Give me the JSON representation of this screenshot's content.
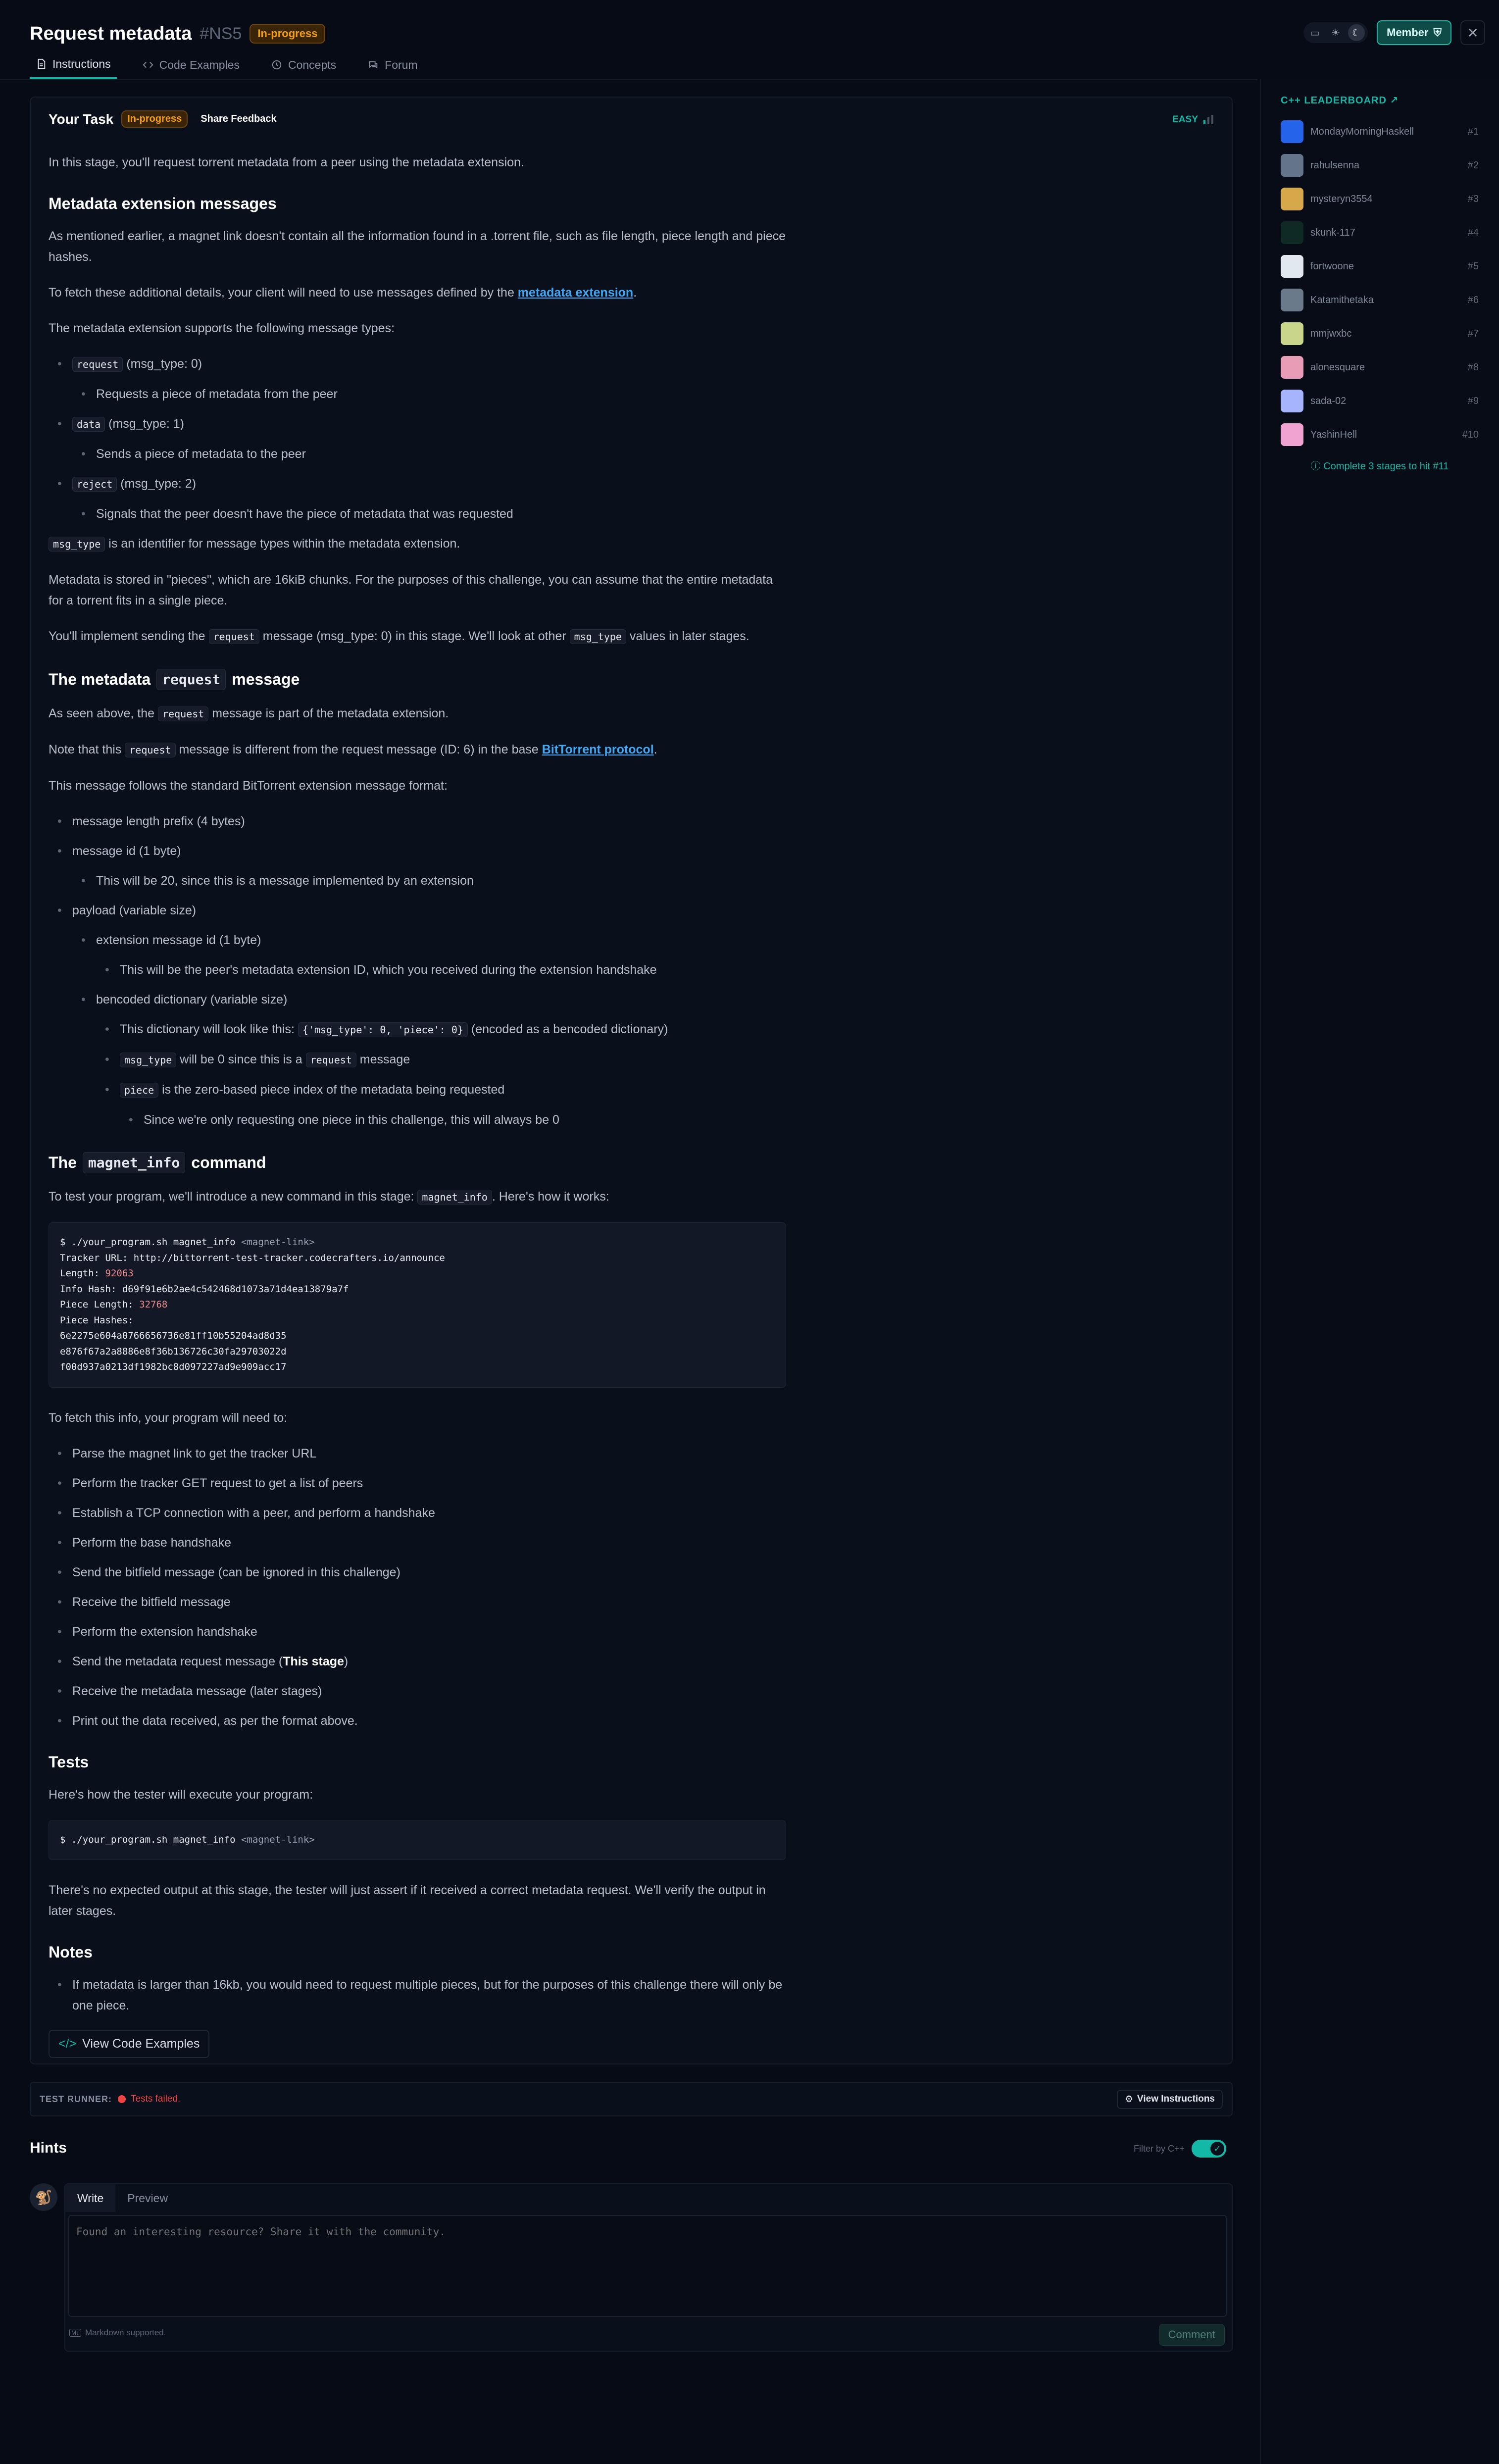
{
  "header": {
    "title": "Request metadata",
    "stage_code": "#NS5",
    "status": "In-progress",
    "member_label": "Member",
    "close": "×",
    "tabs": [
      {
        "label": "Instructions",
        "active": true,
        "icon": "document-icon"
      },
      {
        "label": "Code Examples",
        "icon": "code-icon"
      },
      {
        "label": "Concepts",
        "icon": "concepts-icon"
      },
      {
        "label": "Forum",
        "icon": "forum-icon"
      }
    ],
    "theme_icons": [
      "monitor-icon",
      "sun-icon",
      "moon-icon"
    ]
  },
  "task": {
    "heading": "Your Task",
    "status": "In-progress",
    "feedback_label": "Share Feedback",
    "difficulty": "EASY",
    "intro": "In this stage, you'll request torrent metadata from a peer using the metadata extension.",
    "s1_title": "Metadata extension messages",
    "s1_p1": "As mentioned earlier, a magnet link doesn't contain all the information found in a .torrent file, such as file length, piece length and piece hashes.",
    "s1_p2_a": "To fetch these additional details, your client will need to use messages defined by the ",
    "s1_p2_link": "metadata extension",
    "s1_p2_b": ".",
    "s1_p3": "The metadata extension supports the following message types:",
    "msg_types": [
      {
        "code": "request",
        "text": " (msg_type: 0)",
        "desc": "Requests a piece of metadata from the peer"
      },
      {
        "code": "data",
        "text": " (msg_type: 1)",
        "desc": "Sends a piece of metadata to the peer"
      },
      {
        "code": "reject",
        "text": " (msg_type: 2)",
        "desc": "Signals that the peer doesn't have the piece of metadata that was requested"
      }
    ],
    "msgtype_code": "msg_type",
    "msgtype_text": " is an identifier for message types within the metadata extension.",
    "s1_p5": "Metadata is stored in \"pieces\", which are 16kiB chunks. For the purposes of this challenge, you can assume that the entire metadata for a torrent fits in a single piece.",
    "s1_p6_a": "You'll implement sending the ",
    "s1_p6_code1": "request",
    "s1_p6_b": " message (msg_type: 0) in this stage. We'll look at other ",
    "s1_p6_code2": "msg_type",
    "s1_p6_c": " values in later stages.",
    "s2_title_a": "The metadata",
    "s2_title_code": "request",
    "s2_title_b": "message",
    "s2_p1_a": "As seen above, the ",
    "s2_p1_code": "request",
    "s2_p1_b": " message is part of the metadata extension.",
    "s2_p2_a": "Note that this ",
    "s2_p2_code": "request",
    "s2_p2_b": " message is different from the request message (ID: 6) in the base ",
    "s2_p2_link": "BitTorrent protocol",
    "s2_p2_c": ".",
    "s2_p3": "This message follows the standard BitTorrent extension message format:",
    "fmt": {
      "len_prefix": "message length prefix (4 bytes)",
      "msg_id": "message id (1 byte)",
      "msg_id_note": "This will be 20, since this is a message implemented by an extension",
      "payload": "payload (variable size)",
      "ext_id": "extension message id (1 byte)",
      "ext_id_note": "This will be the peer's metadata extension ID, which you received during the extension handshake",
      "bencoded": "bencoded dictionary (variable size)",
      "dict_a": "This dictionary will look like this: ",
      "dict_code": "{'msg_type': 0, 'piece': 0}",
      "dict_b": " (encoded as a bencoded dictionary)",
      "mt_code": "msg_type",
      "mt_a": " will be 0 since this is a ",
      "mt_code2": "request",
      "mt_b": " message",
      "piece_code": "piece",
      "piece_text": " is the zero-based piece index of the metadata being requested",
      "piece_note": "Since we're only requesting one piece in this challenge, this will always be 0"
    },
    "s3_title_a": "The",
    "s3_title_code": "magnet_info",
    "s3_title_b": "command",
    "s3_p1_a": "To test your program, we'll introduce a new command in this stage: ",
    "s3_p1_code": "magnet_info",
    "s3_p1_b": ". Here's how it works:",
    "code1": {
      "cmd": "$ ./your_program.sh magnet_info ",
      "cmd_arg": "<magnet-link>",
      "tracker": "Tracker URL: http://bittorrent-test-tracker.codecrafters.io/announce",
      "length_label": "Length: ",
      "length_value": "92063",
      "info_hash": "Info Hash: d69f91e6b2ae4c542468d1073a71d4ea13879a7f",
      "piece_len_label": "Piece Length: ",
      "piece_len_value": "32768",
      "hashes_label": "Piece Hashes:",
      "hash1": "6e2275e604a0766656736e81ff10b55204ad8d35",
      "hash2": "e876f67a2a8886e8f36b136726c30fa29703022d",
      "hash3": "f00d937a0213df1982bc8d097227ad9e909acc17"
    },
    "s3_p2": "To fetch this info, your program will need to:",
    "steps": [
      "Parse the magnet link to get the tracker URL",
      "Perform the tracker GET request to get a list of peers",
      "Establish a TCP connection with a peer, and perform a handshake",
      "Perform the base handshake",
      "Send the bitfield message (can be ignored in this challenge)",
      "Receive the bitfield message",
      "Perform the extension handshake"
    ],
    "step8_a": "Send the metadata request message (",
    "step8_bold": "This stage",
    "step8_b": ")",
    "step9": "Receive the metadata message (later stages)",
    "step10": "Print out the data received, as per the format above.",
    "tests_title": "Tests",
    "tests_p1": "Here's how the tester will execute your program:",
    "code2": {
      "cmd": "$ ./your_program.sh magnet_info ",
      "cmd_arg": "<magnet-link>"
    },
    "tests_p2": "There's no expected output at this stage, the tester will just assert if it received a correct metadata request. We'll verify the output in later stages.",
    "notes_title": "Notes",
    "note1": "If metadata is larger than 16kb, you would need to request multiple pieces, but for the purposes of this challenge there will only be one piece.",
    "view_examples_label": "View Code Examples"
  },
  "test_runner": {
    "label": "TEST RUNNER:",
    "status": "Tests failed.",
    "view_instructions": "View Instructions"
  },
  "hints": {
    "title": "Hints",
    "filter_label": "Filter by C++",
    "write_tab": "Write",
    "preview_tab": "Preview",
    "placeholder": "Found an interesting resource? Share it with the community.",
    "markdown_note": "Markdown supported.",
    "comment_button": "Comment"
  },
  "leaderboard": {
    "title": "C++ LEADERBOARD ↗",
    "entries": [
      {
        "name": "MondayMorningHaskell",
        "rank": "#1",
        "color": "#2563eb"
      },
      {
        "name": "rahulsenna",
        "rank": "#2",
        "color": "#64748b"
      },
      {
        "name": "mysteryn3554",
        "rank": "#3",
        "color": "#d6a84a"
      },
      {
        "name": "skunk-117",
        "rank": "#4",
        "color": "#0f2a24"
      },
      {
        "name": "fortwoone",
        "rank": "#5",
        "color": "#e2e8f0"
      },
      {
        "name": "Katamithetaka",
        "rank": "#6",
        "color": "#6b7a8a"
      },
      {
        "name": "mmjwxbc",
        "rank": "#7",
        "color": "#c9d58a"
      },
      {
        "name": "alonesquare",
        "rank": "#8",
        "color": "#e89cb6"
      },
      {
        "name": "sada-02",
        "rank": "#9",
        "color": "#a5b4fc"
      },
      {
        "name": "YashinHell",
        "rank": "#10",
        "color": "#f0a3d0"
      }
    ],
    "hint": "Complete 3 stages to hit #11"
  },
  "colors": {
    "accent": "#14b8a6",
    "warning": "#f59e0b",
    "error": "#ef4444",
    "link": "#3fa9f5"
  }
}
